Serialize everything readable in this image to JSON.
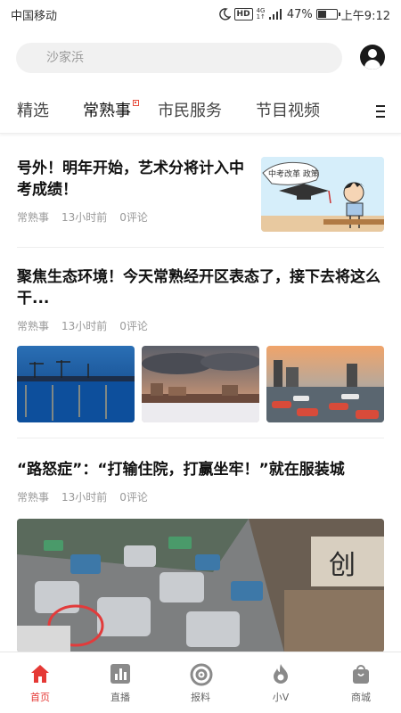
{
  "status_bar": {
    "carrier": "中国移动",
    "hd": "HD",
    "net_top": "4G",
    "net_bottom": "1↑",
    "battery_percent": "47%",
    "battery_level": 0.47,
    "time": "上午9:12"
  },
  "search": {
    "placeholder": "沙家浜"
  },
  "tabs": [
    {
      "label": "精选"
    },
    {
      "label": "常熟事"
    },
    {
      "label": "市民服务"
    },
    {
      "label": "节目视频"
    }
  ],
  "articles": [
    {
      "title": "号外！明年开始，艺术分将计入中考成绩！",
      "source": "常熟事",
      "time": "13小时前",
      "comments": "0评论",
      "thumb_text": "中考改革 政策"
    },
    {
      "title": "聚焦生态环境！今天常熟经开区表态了，接下去将这么干...",
      "source": "常熟事",
      "time": "13小时前",
      "comments": "0评论"
    },
    {
      "title": "“路怒症”：“打输住院，打赢坐牢！”就在服装城",
      "source": "常熟事",
      "time": "13小时前",
      "comments": "0评论",
      "shop_sign": "创"
    }
  ],
  "bottom_nav": [
    {
      "label": "首页",
      "icon": "home-icon"
    },
    {
      "label": "直播",
      "icon": "live-chart-icon"
    },
    {
      "label": "报料",
      "icon": "report-target-icon"
    },
    {
      "label": "小V",
      "icon": "flame-icon"
    },
    {
      "label": "商城",
      "icon": "shopping-bag-icon"
    }
  ],
  "colors": {
    "accent": "#e53935",
    "nav_icon": "#8a8a8a"
  }
}
